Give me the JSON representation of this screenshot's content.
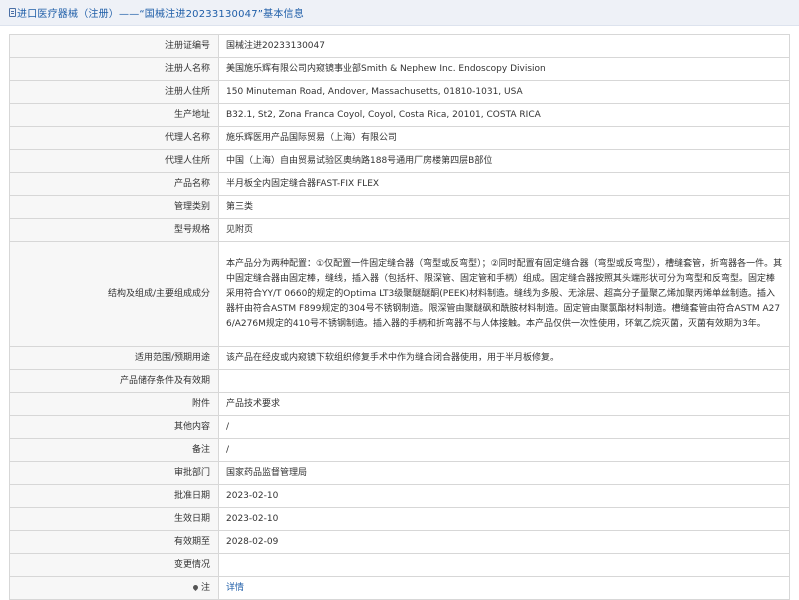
{
  "header": {
    "title": "进口医疗器械（注册）——“国械注进20233130047”基本信息"
  },
  "rows": [
    {
      "label": "注册证编号",
      "value": "国械注进20233130047"
    },
    {
      "label": "注册人名称",
      "value": "美国施乐辉有限公司内窥镜事业部Smith & Nephew Inc. Endoscopy Division"
    },
    {
      "label": "注册人住所",
      "value": "150 Minuteman Road, Andover, Massachusetts, 01810-1031, USA"
    },
    {
      "label": "生产地址",
      "value": "B32.1, St2, Zona Franca Coyol, Coyol, Costa Rica, 20101, COSTA RICA"
    },
    {
      "label": "代理人名称",
      "value": "施乐辉医用产品国际贸易（上海）有限公司"
    },
    {
      "label": "代理人住所",
      "value": "中国（上海）自由贸易试验区奥纳路188号通用厂房楼第四层B部位"
    },
    {
      "label": "产品名称",
      "value": "半月板全内固定缝合器FAST-FIX FLEX"
    },
    {
      "label": "管理类别",
      "value": "第三类"
    },
    {
      "label": "型号规格",
      "value": "见附页"
    },
    {
      "label": "结构及组成/主要组成成分",
      "value": "本产品分为两种配置：①仅配置一件固定缝合器（弯型或反弯型）；②同时配置有固定缝合器（弯型或反弯型），槽缝套管，折弯器各一件。其中固定缝合器由固定棒，缝线，插入器（包括杆、限深管、固定管和手柄）组成。固定缝合器按照其头端形状可分为弯型和反弯型。固定棒采用符合YY/T 0660的规定的Optima LT3级聚醚醚酮(PEEK)材料制造。缝线为多股、无涂层、超高分子量聚乙烯加聚丙烯单丝制造。插入器杆由符合ASTM F899规定的304号不锈钢制造。限深管由聚醚砜和酰胺材料制造。固定管由聚氯酯材料制造。槽缝套管由符合ASTM A276/A276M规定的410号不锈钢制造。插入器的手柄和折弯器不与人体接触。本产品仅供一次性使用，环氧乙烷灭菌，灭菌有效期为3年。"
    },
    {
      "label": "适用范围/预期用途",
      "value": "该产品在经皮或内窥镜下软组织修复手术中作为缝合闭合器使用，用于半月板修复。"
    },
    {
      "label": "产品储存条件及有效期",
      "value": ""
    },
    {
      "label": "附件",
      "value": "产品技术要求"
    },
    {
      "label": "其他内容",
      "value": "/"
    },
    {
      "label": "备注",
      "value": "/"
    },
    {
      "label": "审批部门",
      "value": "国家药品监督管理局"
    },
    {
      "label": "批准日期",
      "value": "2023-02-10"
    },
    {
      "label": "生效日期",
      "value": "2023-02-10"
    },
    {
      "label": "有效期至",
      "value": "2028-02-09"
    },
    {
      "label": "变更情况",
      "value": ""
    }
  ],
  "footer_row": {
    "label": "注",
    "link": "详情",
    "icon": "pin-icon"
  },
  "colors": {
    "header_bg": "#eef1f7",
    "title": "#1f5ea8",
    "label_bg": "#f7f7f7",
    "border": "#d7d7d7",
    "link": "#1f5ea8"
  }
}
